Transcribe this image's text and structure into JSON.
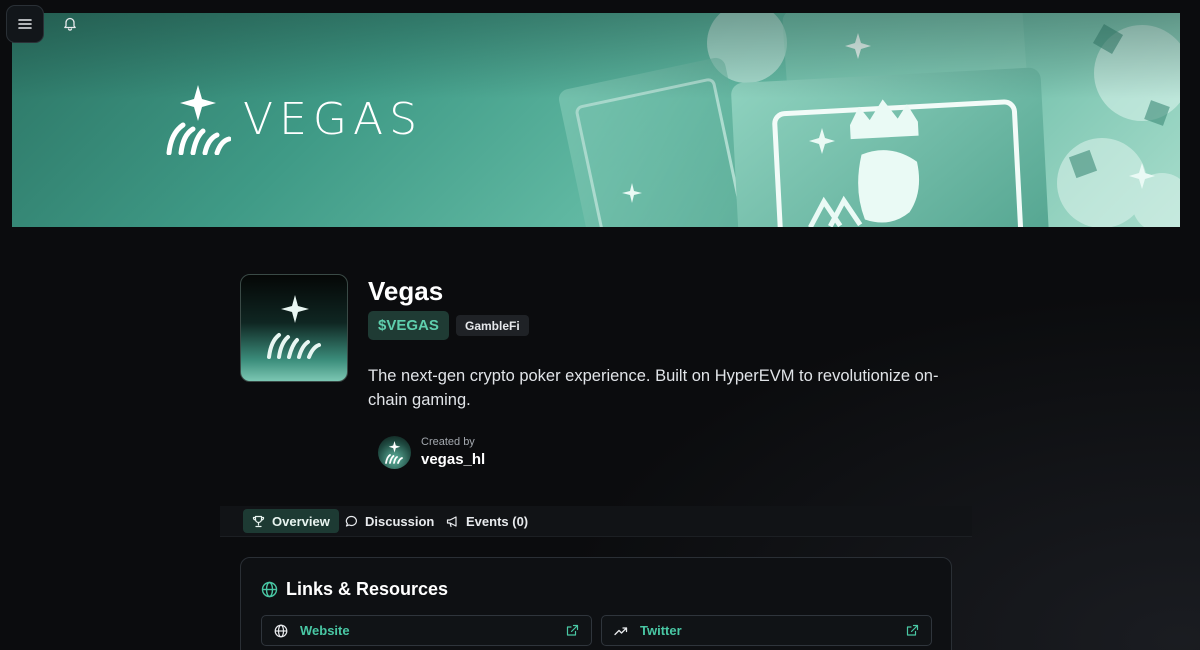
{
  "topbar": {
    "menu_icon": "hamburger-icon",
    "notifications_icon": "bell-icon"
  },
  "banner": {
    "wordmark": "VEGAS",
    "accent": "#4fa893"
  },
  "project": {
    "name": "Vegas",
    "ticker": "$VEGAS",
    "category": "GambleFi",
    "description": "The next-gen crypto poker experience. Built on HyperEVM to revolutionize on-chain gaming.",
    "created_by_label": "Created by",
    "creator": "vegas_hl"
  },
  "tabs": [
    {
      "label": "Overview",
      "icon": "trophy-icon",
      "active": true
    },
    {
      "label": "Discussion",
      "icon": "chat-bubble-icon",
      "active": false
    },
    {
      "label": "Events (0)",
      "icon": "megaphone-icon",
      "active": false
    }
  ],
  "links": {
    "title": "Links & Resources",
    "items": [
      {
        "label": "Website",
        "icon": "globe-icon",
        "action_icon": "external-link-icon"
      },
      {
        "label": "Twitter",
        "icon": "trending-up-icon",
        "action_icon": "external-link-icon"
      }
    ]
  },
  "colors": {
    "background": "#0a0b0d",
    "accent_text": "#49c7a4",
    "ticker_bg": "#1f3b34",
    "active_tab_bg": "#1d3a33"
  }
}
